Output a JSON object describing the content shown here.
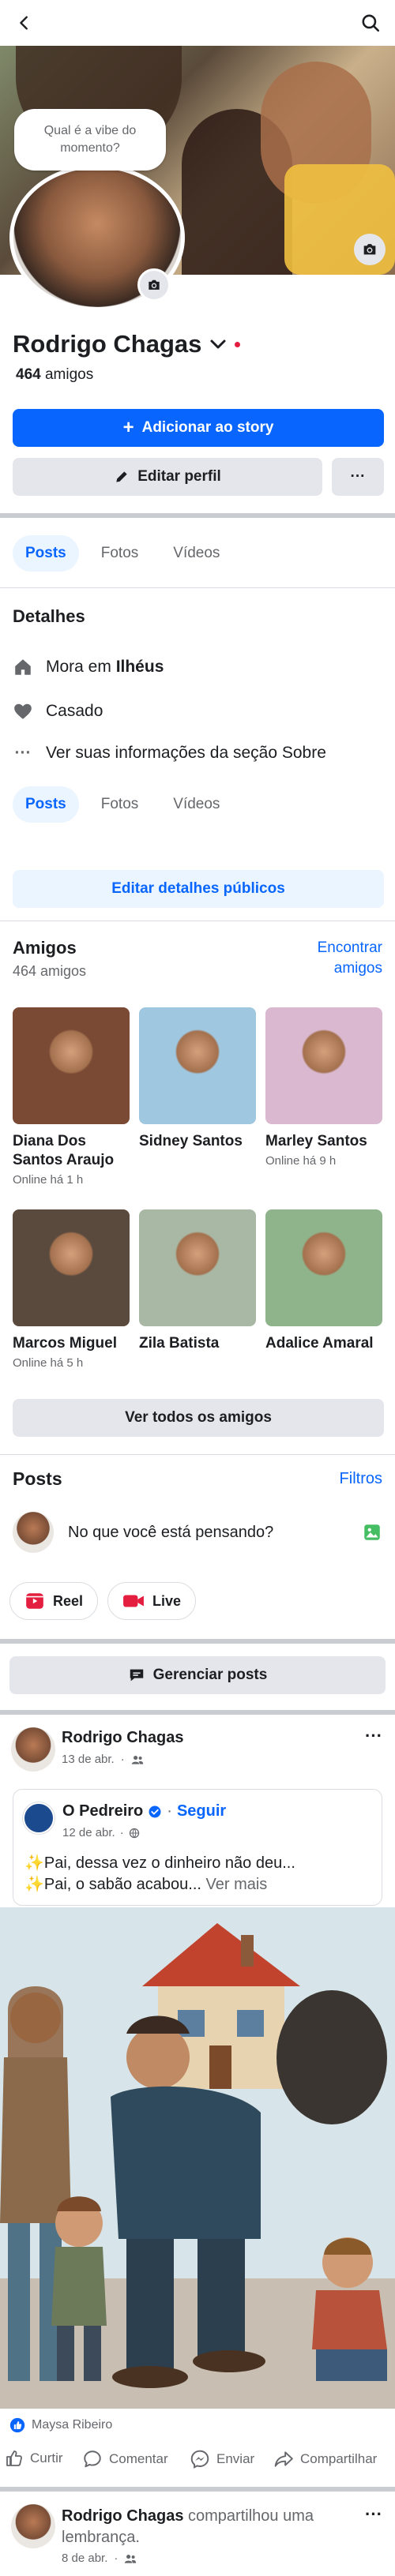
{
  "header": {
    "back_icon": "chevron-left-icon",
    "search_icon": "search-icon"
  },
  "profile": {
    "bubble_text": "Qual é a vibe do momento?",
    "name": "Rodrigo Chagas",
    "friends_number": "464",
    "friends_suffix": " amigos",
    "add_story_label": "Adicionar ao story",
    "edit_profile_label": "Editar perfil",
    "more_label": "···"
  },
  "tabs": {
    "posts": "Posts",
    "photos": "Fotos",
    "videos": "Vídeos"
  },
  "details": {
    "title": "Detalhes",
    "lives_prefix": "Mora em ",
    "lives_city": "Ilhéus",
    "relationship": "Casado",
    "see_about": "Ver suas informações da seção Sobre",
    "edit_public": "Editar detalhes públicos"
  },
  "friends": {
    "title": "Amigos",
    "count": "464 amigos",
    "find_link": "Encontrar amigos",
    "see_all": "Ver todos os amigos",
    "items": [
      {
        "name": "Diana Dos Santos Araujo",
        "status": "Online há 1 h",
        "color": "#7a4a34"
      },
      {
        "name": "Sidney Santos",
        "status": "",
        "color": "#9fc7e0"
      },
      {
        "name": "Marley Santos",
        "status": "Online há 9 h",
        "color": "#d9b8d0"
      },
      {
        "name": "Marcos Miguel",
        "status": "Online há 5 h",
        "color": "#5a4a3e"
      },
      {
        "name": "Zila Batista",
        "status": "",
        "color": "#a8b8a4"
      },
      {
        "name": "Adalice Amaral",
        "status": "",
        "color": "#8fb38a"
      }
    ]
  },
  "posts_section": {
    "title": "Posts",
    "filters": "Filtros",
    "composer_placeholder": "No que você está pensando?",
    "reel": "Reel",
    "live": "Live",
    "manage": "Gerenciar posts"
  },
  "post1": {
    "author": "Rodrigo Chagas",
    "date": "13 de abr.",
    "more": "···",
    "shared_author": "O Pedreiro",
    "follow": "Seguir",
    "shared_date": "12 de abr.",
    "line1": "✨Pai, dessa vez o dinheiro não deu...",
    "line2": "✨Pai, o sabão acabou...",
    "see_more": " Ver mais",
    "reactor": "Maysa Ribeiro",
    "actions": {
      "like": "Curtir",
      "comment": "Comentar",
      "send": "Enviar",
      "share": "Compartilhar"
    }
  },
  "post2": {
    "author": "Rodrigo Chagas",
    "action_text": " compartilhou uma lembrança.",
    "date": "8 de abr.",
    "more": "···"
  },
  "colors": {
    "accent": "#0866ff",
    "light_accent": "#ebf5ff",
    "gray_button": "#e4e6eb",
    "red_dot": "#e41e3f"
  }
}
